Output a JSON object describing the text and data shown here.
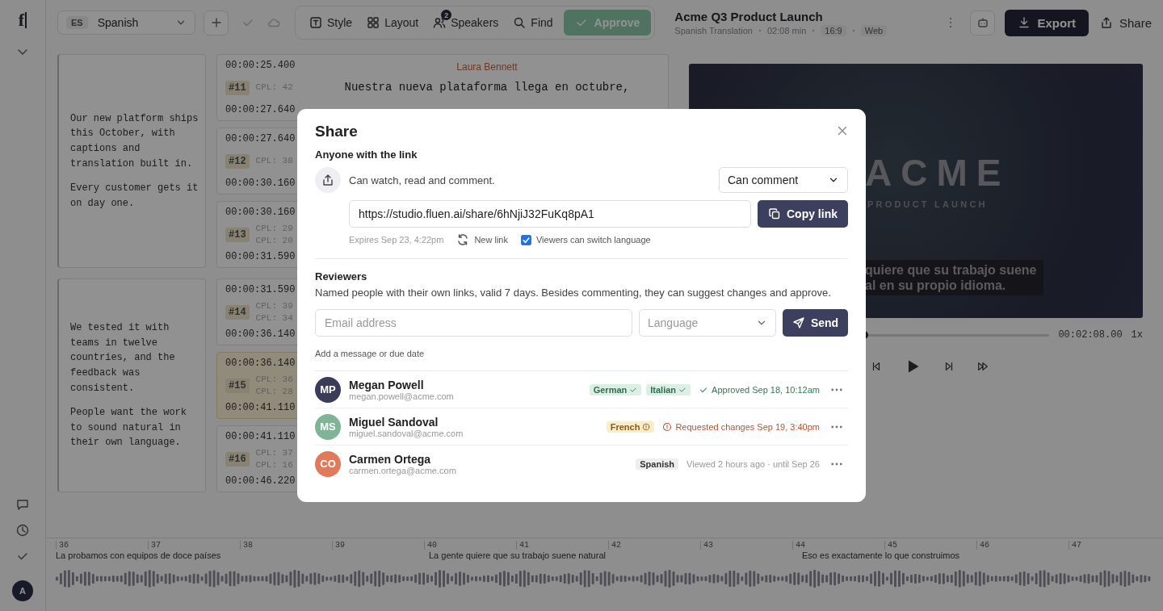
{
  "rail": {
    "logo": "f",
    "avatar": "A"
  },
  "toolbar": {
    "language": {
      "code": "ES",
      "name": "Spanish"
    },
    "tools": [
      {
        "kind": "style",
        "label": "Style"
      },
      {
        "kind": "layout",
        "label": "Layout"
      },
      {
        "kind": "speakers",
        "label": "Speakers",
        "badge": "2"
      },
      {
        "kind": "find",
        "label": "Find"
      }
    ],
    "approve": "Approve"
  },
  "project": {
    "title": "Acme Q3 Product Launch",
    "subtitle": "Spanish Translation",
    "duration": "02:08 min",
    "tags": [
      "16:9",
      "Web"
    ]
  },
  "actions": {
    "export": "Export",
    "share": "Share"
  },
  "paragraphs": [
    [
      "Our new platform ships this October, with captions and translation built in.",
      "Every customer gets it on day one."
    ],
    [
      "We tested it with teams in twelve countries, and the feedback was consistent.",
      "People want the work to sound natural in their own language."
    ]
  ],
  "segments": [
    {
      "start": "00:00:25.400",
      "number": "#11",
      "cpl": [
        "CPL: 42"
      ],
      "end": "00:00:27.640",
      "speaker": "Laura Bennett",
      "text": "Nuestra nueva plataforma llega en octubre,",
      "selected": false
    },
    {
      "start": "00:00:27.640",
      "number": "#12",
      "cpl": [
        "CPL: 38"
      ],
      "end": "00:00:30.160",
      "selected": false
    },
    {
      "start": "00:00:30.160",
      "number": "#13",
      "cpl": [
        "CPL: 29",
        "CPL: 20"
      ],
      "end": "00:00:31.590",
      "selected": false
    },
    {
      "start": "00:00:31.590",
      "number": "#14",
      "cpl": [
        "CPL: 39",
        "CPL: 34"
      ],
      "end": "00:00:36.140",
      "selected": false
    },
    {
      "start": "00:00:36.140",
      "number": "#15",
      "cpl": [
        "CPL: 36",
        "CPL: 28"
      ],
      "end": "00:00:41.110",
      "selected": true
    },
    {
      "start": "00:00:41.110",
      "number": "#16",
      "cpl": [
        "CPL: 37",
        "CPL: 16"
      ],
      "end": "00:00:46.220",
      "selected": false
    }
  ],
  "preview": {
    "title": "ACME",
    "subtitle": "PRODUCT LAUNCH",
    "caption": [
      "quiere que su trabajo suene",
      "al en su propio idioma."
    ],
    "level": 0.48,
    "time": "00:02:08.00",
    "speed": "1x"
  },
  "timeline": {
    "ticks": [
      "36",
      "37",
      "38",
      "39",
      "40",
      "41",
      "42",
      "43",
      "44",
      "45",
      "46",
      "47"
    ],
    "captions": [
      "La probamos con equipos de doce países",
      "La gente quiere que su trabajo suene natural",
      "Eso es exactamente lo que construimos"
    ]
  },
  "share": {
    "title": "Share",
    "link": {
      "heading": "Anyone with the link",
      "description": "Can watch, read and comment.",
      "permission": "Can comment",
      "url": "https://studio.fluen.ai/share/6hNjiJ32FuKq8pA1",
      "copy": "Copy link",
      "expires": "Expires Sep 23, 4:22pm",
      "new_link": "New link",
      "switch_language": {
        "label": "Viewers can switch language",
        "checked": true
      }
    },
    "reviewers": {
      "heading": "Reviewers",
      "description": "Named people with their own links, valid 7 days. Besides commenting, they can suggest changes and approve.",
      "email_placeholder": "Email address",
      "language_placeholder": "Language",
      "send": "Send",
      "message": "Add a message or due date",
      "people": [
        {
          "initials": "MP",
          "name": "Megan Powell",
          "email": "megan.powell@acme.com",
          "color": "#3b3c58",
          "languages": [
            {
              "label": "German",
              "kind": "approved"
            },
            {
              "label": "Italian",
              "kind": "approved"
            }
          ],
          "status": {
            "kind": "approved",
            "text": "Approved Sep 18, 10:12am"
          }
        },
        {
          "initials": "MS",
          "name": "Miguel Sandoval",
          "email": "miguel.sandoval@acme.com",
          "color": "#7fb597",
          "languages": [
            {
              "label": "French",
              "kind": "changes"
            }
          ],
          "status": {
            "kind": "changes",
            "text": "Requested changes Sep 19, 3:40pm"
          }
        },
        {
          "initials": "CO",
          "name": "Carmen Ortega",
          "email": "carmen.ortega@acme.com",
          "color": "#e07a5a",
          "languages": [
            {
              "label": "Spanish",
              "kind": "pending"
            }
          ],
          "status": {
            "kind": "viewed",
            "text": "Viewed 2 hours ago · until Sep 26"
          }
        }
      ]
    }
  }
}
